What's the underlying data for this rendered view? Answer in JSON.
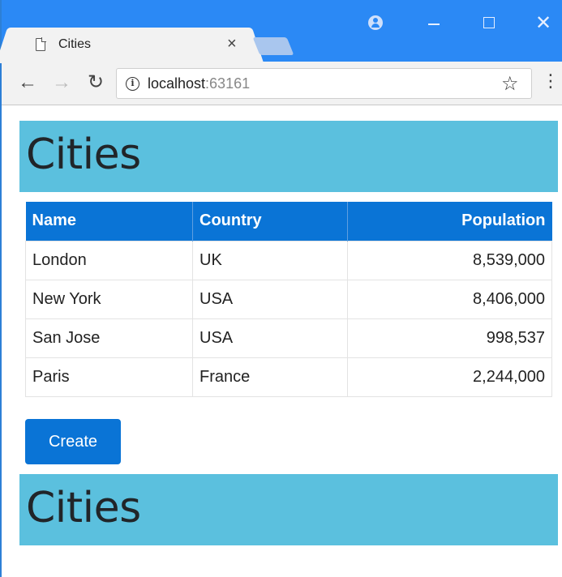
{
  "browser": {
    "tab": {
      "title": "Cities",
      "close": "×"
    },
    "address": {
      "host": "localhost",
      "port": ":63161"
    }
  },
  "page": {
    "heading_top": "Cities",
    "heading_bottom": "Cities",
    "table": {
      "headers": [
        "Name",
        "Country",
        "Population"
      ],
      "rows": [
        [
          "London",
          "UK",
          "8,539,000"
        ],
        [
          "New York",
          "USA",
          "8,406,000"
        ],
        [
          "San Jose",
          "USA",
          "998,537"
        ],
        [
          "Paris",
          "France",
          "2,244,000"
        ]
      ]
    },
    "create_label": "Create"
  },
  "colors": {
    "chrome_blue": "#2b89f5",
    "jumbotron": "#5bc0de",
    "primary": "#0a74d6"
  }
}
